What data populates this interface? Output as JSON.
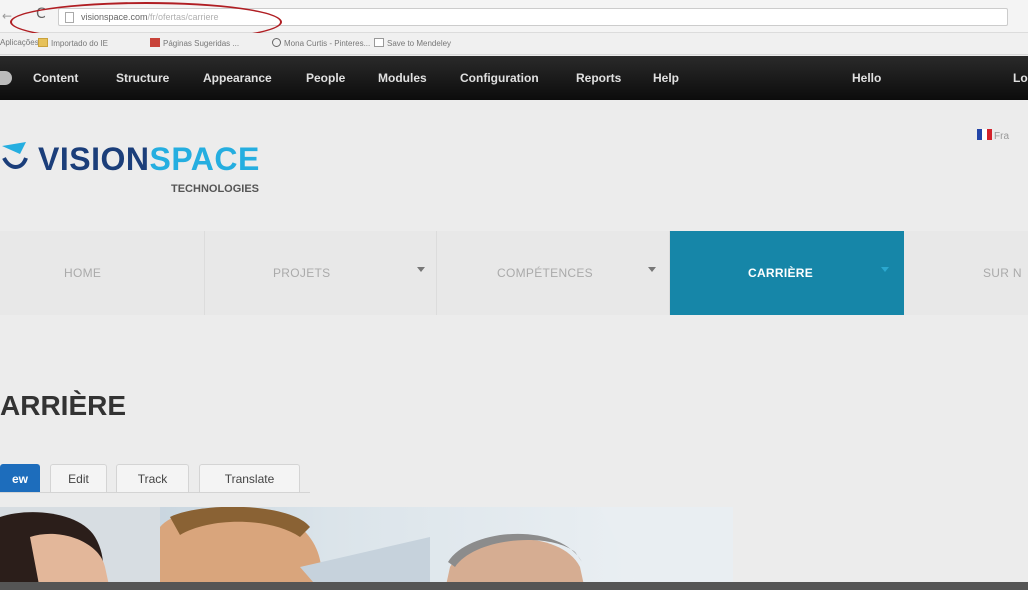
{
  "browser": {
    "url_host": "visionspace.com",
    "url_path": "/fr/ofertas/carriere",
    "bookmarks": [
      "Aplicações",
      "Importado do IE",
      "Páginas Sugeridas ...",
      "Mona Curtis - Pinteres...",
      "Save to Mendeley"
    ]
  },
  "admin_toolbar": {
    "items": [
      "Content",
      "Structure",
      "Appearance",
      "People",
      "Modules",
      "Configuration",
      "Reports",
      "Help"
    ],
    "greeting": "Hello",
    "right_cut": "Lo"
  },
  "logo": {
    "word_a": "VISION",
    "word_b": "SPACE",
    "sub": "TECHNOLOGIES",
    "brand_dark": "#1b3e7a",
    "brand_light": "#25aee0"
  },
  "language": {
    "label": "Fra",
    "flag": "france-flag-icon"
  },
  "main_nav": {
    "items": [
      {
        "label": "HOME",
        "has_dropdown": false,
        "active": false
      },
      {
        "label": "PROJETS",
        "has_dropdown": true,
        "active": false
      },
      {
        "label": "COMPÉTENCES",
        "has_dropdown": true,
        "active": false
      },
      {
        "label": "CARRIÈRE",
        "has_dropdown": true,
        "active": true
      },
      {
        "label": "SUR N",
        "has_dropdown": false,
        "active": false
      }
    ],
    "active_color": "#1686a8"
  },
  "page": {
    "title": "ARRIÈRE",
    "tabs": [
      "ew",
      "Edit",
      "Track",
      "Translate"
    ],
    "active_tab_color": "#1d6dbc"
  }
}
